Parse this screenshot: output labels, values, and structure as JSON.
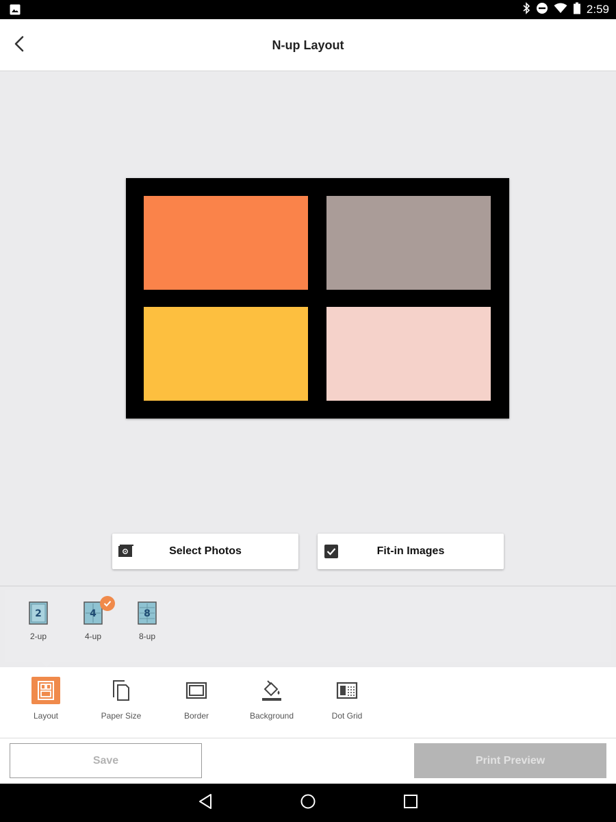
{
  "status_bar": {
    "time": "2:59",
    "icons": [
      "image-icon",
      "bluetooth-icon",
      "do-not-disturb-icon",
      "wifi-icon",
      "battery-icon"
    ]
  },
  "app_bar": {
    "title": "N-up Layout",
    "back_icon": "chevron-left-icon"
  },
  "preview": {
    "background_color": "#000000",
    "cells": [
      {
        "color": "#fa834a"
      },
      {
        "color": "#aa9c98"
      },
      {
        "color": "#fdbf3f"
      },
      {
        "color": "#f5d2ca"
      }
    ]
  },
  "actions": {
    "select_photos": {
      "label": "Select Photos",
      "icon": "photo-album-icon"
    },
    "fit_in_images": {
      "label": "Fit-in Images",
      "icon": "checkbox-checked-icon",
      "checked": true
    }
  },
  "layout_options": [
    {
      "number": "2",
      "label": "2-up",
      "selected": false
    },
    {
      "number": "4",
      "label": "4-up",
      "selected": true
    },
    {
      "number": "8",
      "label": "8-up",
      "selected": false
    }
  ],
  "tools": [
    {
      "label": "Layout",
      "icon": "layout-icon",
      "active": true
    },
    {
      "label": "Paper Size",
      "icon": "paper-size-icon",
      "active": false
    },
    {
      "label": "Border",
      "icon": "border-icon",
      "active": false
    },
    {
      "label": "Background",
      "icon": "paint-bucket-icon",
      "active": false
    },
    {
      "label": "Dot Grid",
      "icon": "dot-grid-icon",
      "active": false
    }
  ],
  "bottom": {
    "save_label": "Save",
    "preview_label": "Print Preview"
  },
  "colors": {
    "accent": "#f08a4b",
    "disabled_button": "#b5b5b5"
  }
}
